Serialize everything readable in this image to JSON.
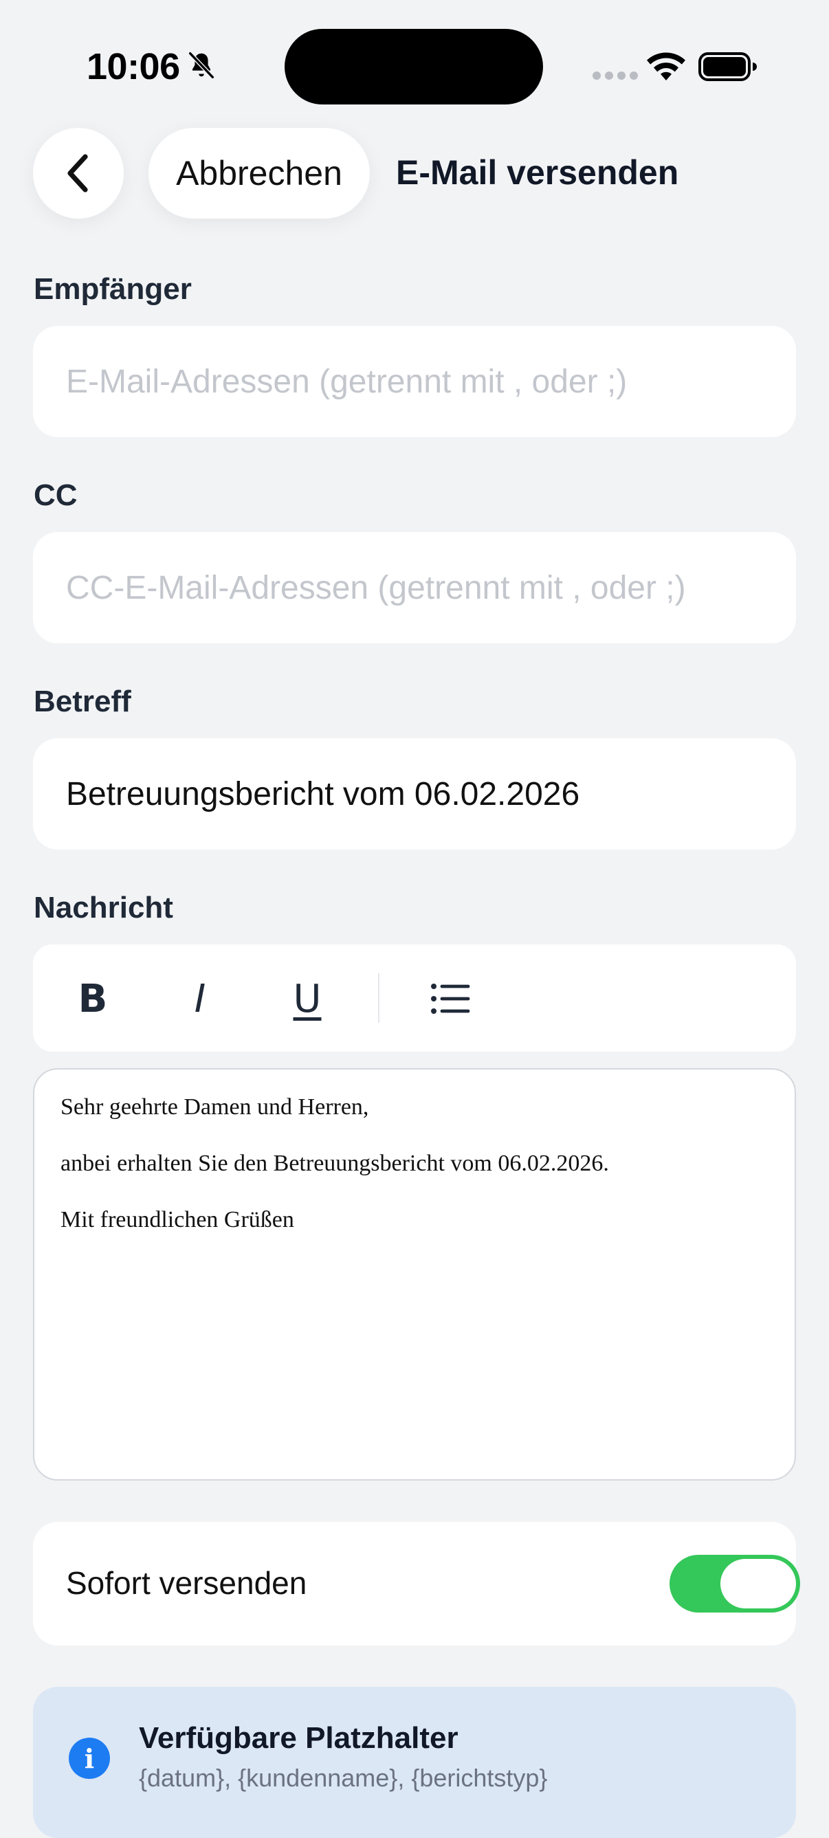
{
  "status_bar": {
    "time": "10:06",
    "icons": [
      "bell-slash-icon",
      "signal-icon",
      "wifi-icon",
      "battery-icon"
    ]
  },
  "header": {
    "back_icon": "chevron-left-icon",
    "cancel_label": "Abbrechen",
    "title": "E-Mail versenden"
  },
  "form": {
    "recipients": {
      "label": "Empfänger",
      "value": "",
      "placeholder": "E-Mail-Adressen (getrennt mit , oder ;)"
    },
    "cc": {
      "label": "CC",
      "value": "",
      "placeholder": "CC-E-Mail-Adressen (getrennt mit , oder ;)"
    },
    "subject": {
      "label": "Betreff",
      "value": "Betreuungsbericht vom 06.02.2026"
    },
    "message": {
      "label": "Nachricht",
      "toolbar": {
        "bold": "B",
        "italic": "I",
        "underline": "U",
        "list_icon": "bullet-list-icon"
      },
      "paragraphs": [
        "Sehr geehrte Damen und Herren,",
        "anbei erhalten Sie den Betreuungsbericht vom 06.02.2026.",
        "Mit freundlichen Grüßen"
      ]
    },
    "send_immediately": {
      "label": "Sofort versenden",
      "checked": true
    }
  },
  "info": {
    "icon": "info-icon",
    "title": "Verfügbare Platzhalter",
    "text": "{datum}, {kundenname}, {berichtstyp}"
  },
  "colors": {
    "background": "#f2f3f5",
    "toggle_on": "#34c759",
    "info_bg": "#dbe7f5",
    "info_icon": "#1d7cf2"
  }
}
